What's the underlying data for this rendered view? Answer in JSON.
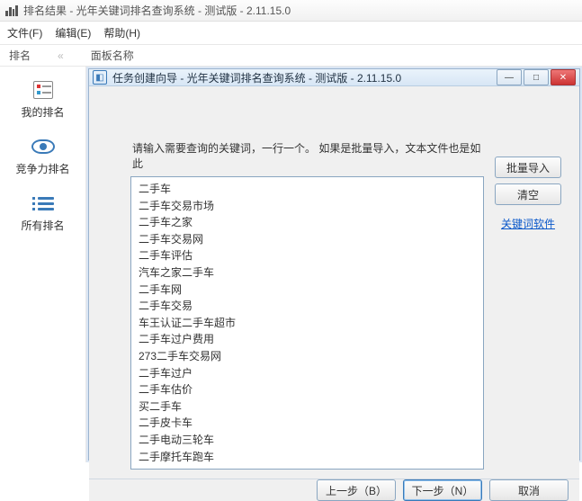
{
  "titlebar": {
    "title": "排名结果 - 光年关键词排名查询系统 - 测试版 - 2.11.15.0"
  },
  "menu": {
    "file": "文件(F)",
    "edit": "编辑(E)",
    "help": "帮助(H)"
  },
  "toolbar": {
    "rank": "排名",
    "panel_name": "面板名称"
  },
  "sidebar": {
    "my_rank": "我的排名",
    "compete_rank": "竞争力排名",
    "all_rank": "所有排名"
  },
  "wizard": {
    "title": "任务创建向导 - 光年关键词排名查询系统 - 测试版 - 2.11.15.0",
    "instruction": "请输入需要查询的关键词，一行一个。 如果是批量导入，文本文件也是如此",
    "keywords": "二手车\n二手车交易市场\n二手车之家\n二手车交易网\n二手车评估\n汽车之家二手车\n二手车网\n二手车交易\n车王认证二手车超市\n二手车过户费用\n273二手车交易网\n二手车过户\n二手车估价\n买二手车\n二手皮卡车\n二手电动三轮车\n二手摩托车跑车",
    "btn_import": "批量导入",
    "btn_clear": "清空",
    "link_kw": "关键词软件",
    "btn_prev": "上一步（B）",
    "btn_next": "下一步（N）",
    "btn_cancel": "取消"
  }
}
